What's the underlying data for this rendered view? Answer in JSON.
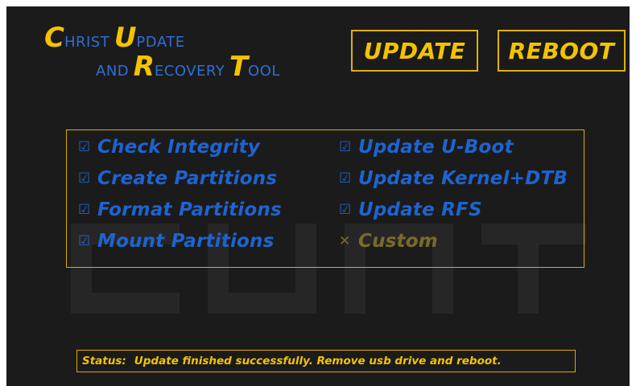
{
  "app": {
    "title_line1": [
      {
        "cap": "C",
        "rest": "HRIST"
      },
      {
        "cap": "U",
        "rest": "PDATE"
      }
    ],
    "title_line2": [
      {
        "cap": "",
        "rest": "AND"
      },
      {
        "cap": "R",
        "rest": "ECOVERY"
      },
      {
        "cap": "T",
        "rest": "OOL"
      }
    ]
  },
  "watermark": "CURT",
  "buttons": {
    "update_label": "UPDATE",
    "reboot_label": "REBOOT"
  },
  "steps": [
    {
      "label": "Check Integrity",
      "mark": "☑",
      "status": "done"
    },
    {
      "label": "Create Partitions",
      "mark": "☑",
      "status": "done"
    },
    {
      "label": "Format Partitions",
      "mark": "☑",
      "status": "done"
    },
    {
      "label": "Mount Partitions",
      "mark": "☑",
      "status": "done"
    },
    {
      "label": "Update U-Boot",
      "mark": "☑",
      "status": "done"
    },
    {
      "label": "Update Kernel+DTB",
      "mark": "☑",
      "status": "done"
    },
    {
      "label": "Update RFS",
      "mark": "☑",
      "status": "done"
    },
    {
      "label": "Custom",
      "mark": "✕",
      "status": "skipped"
    }
  ],
  "status": {
    "key": "Status:",
    "message": "Update finished successfully. Remove usb drive and reboot."
  },
  "colors": {
    "background": "#1b1b1b",
    "accent_yellow": "#f3c300",
    "done_blue": "#1f63cf",
    "skipped": "#7a6a2a",
    "watermark": "#262626"
  }
}
